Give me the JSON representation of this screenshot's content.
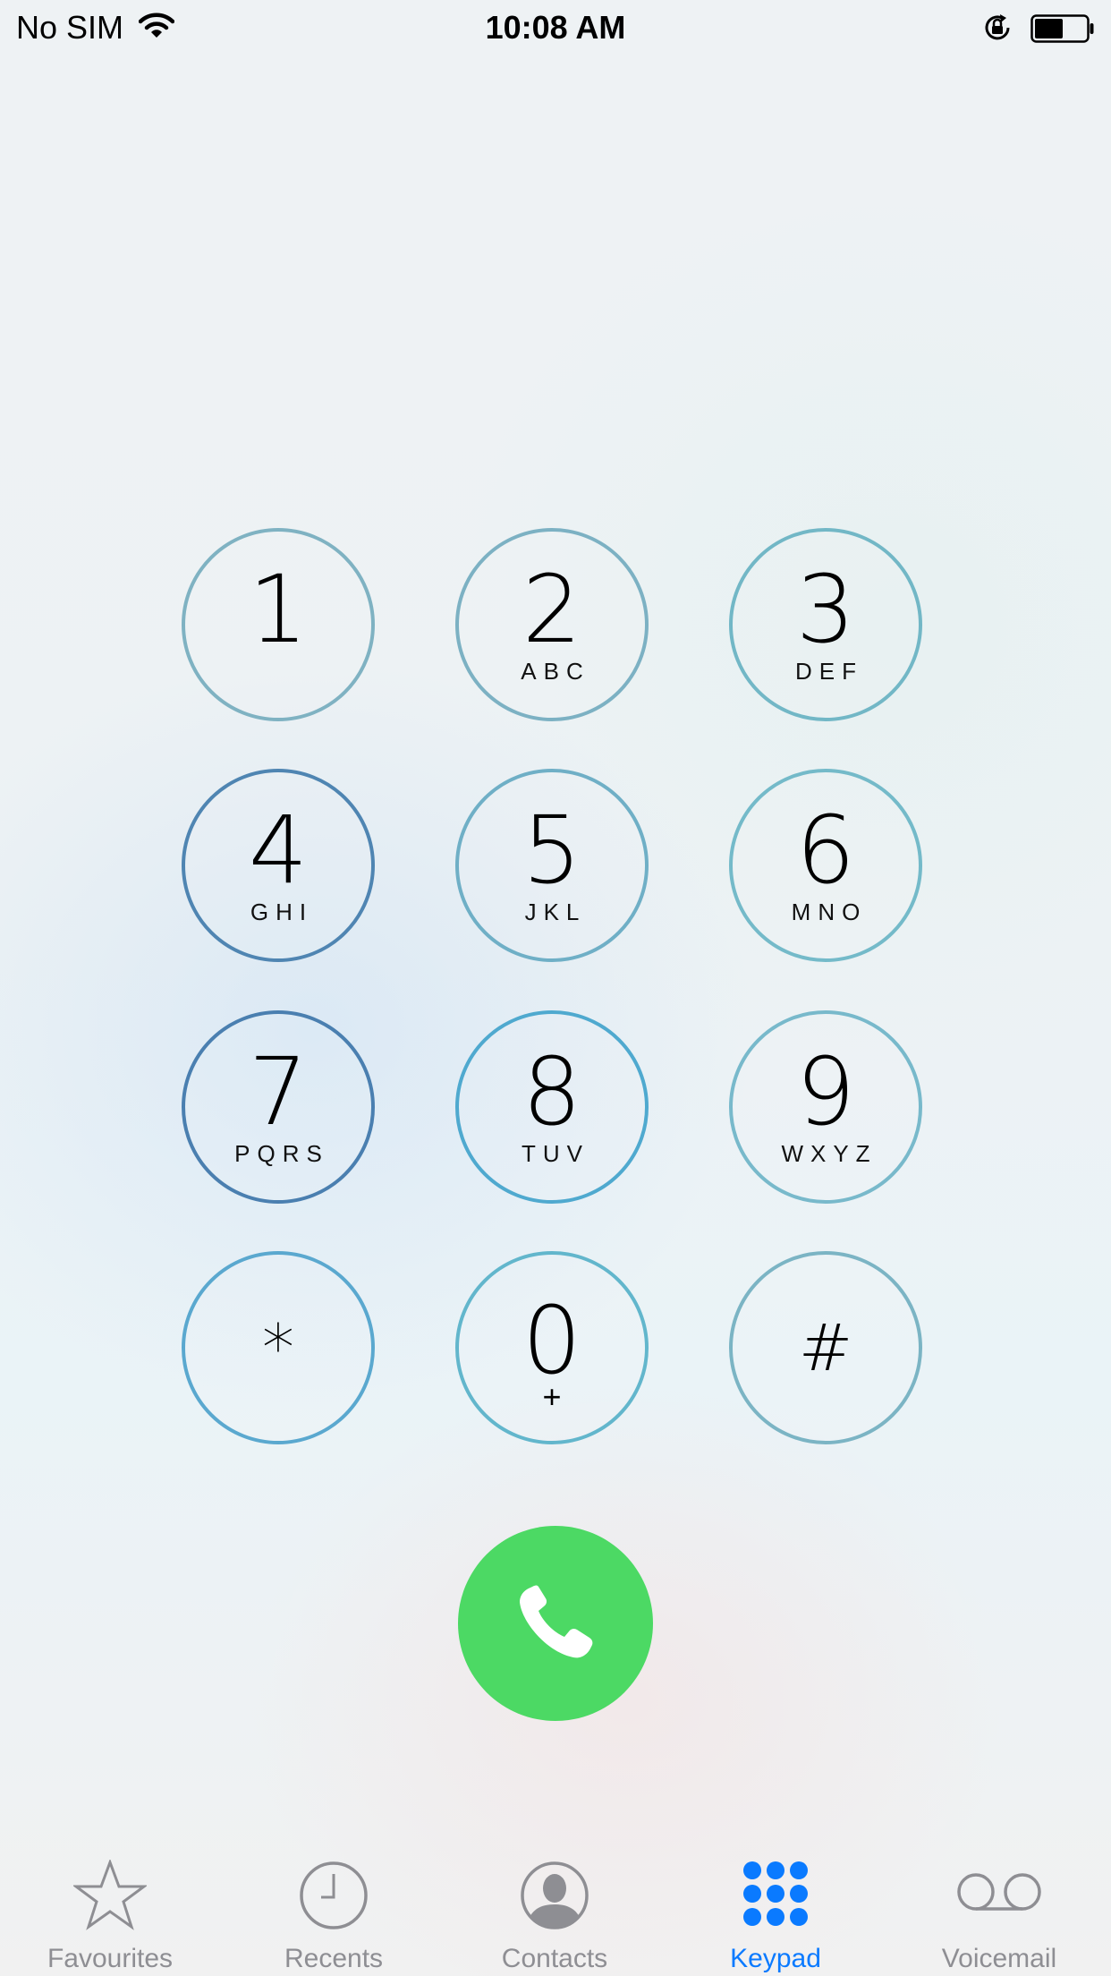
{
  "status_bar": {
    "carrier": "No SIM",
    "time": "10:08 AM",
    "icons": [
      "wifi-icon",
      "orientation-lock-icon",
      "battery-icon"
    ],
    "battery_level": 0.55
  },
  "keypad": {
    "keys": [
      {
        "digit": "1",
        "letters": ""
      },
      {
        "digit": "2",
        "letters": "ABC"
      },
      {
        "digit": "3",
        "letters": "DEF"
      },
      {
        "digit": "4",
        "letters": "GHI"
      },
      {
        "digit": "5",
        "letters": "JKL"
      },
      {
        "digit": "6",
        "letters": "MNO"
      },
      {
        "digit": "7",
        "letters": "PQRS"
      },
      {
        "digit": "8",
        "letters": "TUV"
      },
      {
        "digit": "9",
        "letters": "WXYZ"
      },
      {
        "digit": "*",
        "letters": ""
      },
      {
        "digit": "0",
        "letters": "+"
      },
      {
        "digit": "#",
        "letters": ""
      }
    ]
  },
  "call_button": {
    "icon": "phone-icon",
    "color": "#4cd964"
  },
  "tabs": [
    {
      "label": "Favourites",
      "icon": "star-icon",
      "active": false
    },
    {
      "label": "Recents",
      "icon": "clock-icon",
      "active": false
    },
    {
      "label": "Contacts",
      "icon": "contact-icon",
      "active": false
    },
    {
      "label": "Keypad",
      "icon": "keypad-icon",
      "active": true
    },
    {
      "label": "Voicemail",
      "icon": "voicemail-icon",
      "active": false
    }
  ],
  "colors": {
    "accent": "#0a7aff",
    "tab_inactive": "#8e8e93",
    "call_green": "#4cd964"
  }
}
